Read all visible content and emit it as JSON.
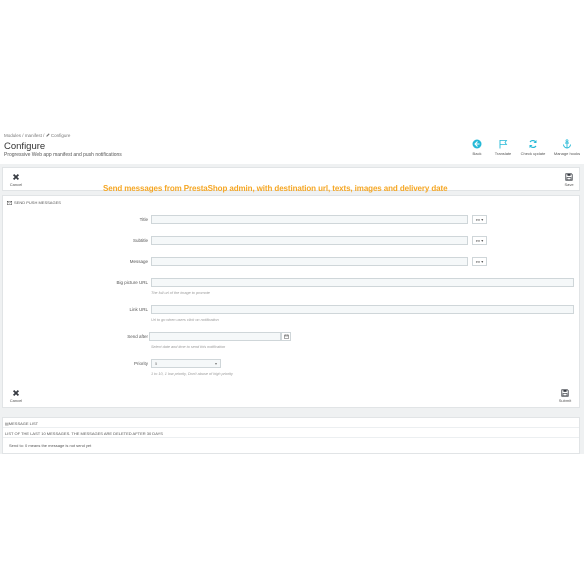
{
  "header": {
    "breadcrumb": [
      "Modules",
      "manifest",
      "Configure"
    ],
    "breadcrumb_sep": "/",
    "title": "Configure",
    "subtitle": "Progressive Web app manifest and push notifications",
    "toolbar": [
      {
        "label": "Back",
        "icon": "back-circle-icon"
      },
      {
        "label": "Translate",
        "icon": "flag-icon"
      },
      {
        "label": "Check update",
        "icon": "refresh-icon"
      },
      {
        "label": "Manage hooks",
        "icon": "anchor-icon"
      }
    ]
  },
  "top_bar": {
    "cancel_label": "Cancel",
    "save_label": "Save",
    "promo_text": "Send messages from PrestaShop admin, with destination url, texts, images and delivery date"
  },
  "form": {
    "heading": "SEND PUSH MESSAGES",
    "fields": {
      "title": {
        "label": "Title",
        "lang": "en"
      },
      "subtitle": {
        "label": "Subtitle",
        "lang": "en"
      },
      "message": {
        "label": "Message",
        "lang": "en"
      },
      "big_picture": {
        "label": "Big picture URL",
        "help": "The full url of the image to promote"
      },
      "link_url": {
        "label": "Link URL",
        "help": "Url to go when users click on notification"
      },
      "send_after": {
        "label": "Send after",
        "help": "Select date and time to send this notification"
      },
      "priority": {
        "label": "Priority",
        "value": "5",
        "help": "1 to 10, 1 low priority, Don't abuse of high priority"
      }
    },
    "cancel_label": "Cancel",
    "submit_label": "Submit"
  },
  "message_list": {
    "heading": "MESSAGE LIST",
    "subheading": "LIST OF THE LAST 10 MESSAGES. THE MESSAGES ARE DELETED AFTER 30 DAYS",
    "note": "Send to: 0 means the message is not send yet"
  },
  "colors": {
    "accent": "#25b9d7",
    "promo": "#f5a623",
    "background": "#eff1f2"
  }
}
